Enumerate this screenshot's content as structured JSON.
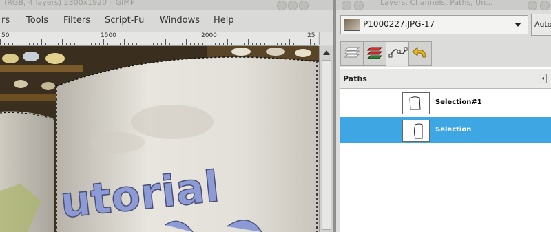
{
  "left_window": {
    "title": "(RGB, 4 layers) 2300x1920 – GIMP",
    "menu": [
      {
        "label": "rs"
      },
      {
        "label": "Tools"
      },
      {
        "label": "Filters"
      },
      {
        "label": "Script-Fu"
      },
      {
        "label": "Windows"
      },
      {
        "label": "Help"
      }
    ],
    "ruler_labels": [
      "50",
      "1500",
      "2000",
      "25"
    ],
    "canvas_text": "utorial"
  },
  "right_window": {
    "title": "Layers, Channels, Paths, Un...",
    "image_selector": {
      "value": "P1000227.JPG-17"
    },
    "auto_button": "Auto",
    "tabs": [
      {
        "icon": "layers-icon"
      },
      {
        "icon": "channels-icon"
      },
      {
        "icon": "paths-icon"
      },
      {
        "icon": "undo-history-icon"
      }
    ],
    "paths_panel": {
      "title": "Paths",
      "items": [
        {
          "label": "Selection#1",
          "selected": false
        },
        {
          "label": "Selection",
          "selected": true
        }
      ]
    }
  },
  "colors": {
    "selection_highlight": "#3ea6e2",
    "panel_bg": "#ffffff",
    "chrome_bg": "#d8d8d6"
  }
}
